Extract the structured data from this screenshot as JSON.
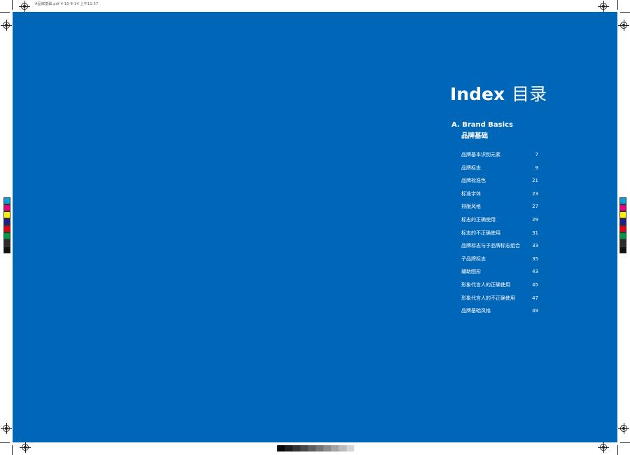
{
  "slug_text": "A品牌基础.pdf  4   10-8-14   上午11:57",
  "colors": {
    "page_blue": "#0066b8",
    "text": "#ffffff"
  },
  "toc": {
    "title_en": "Index",
    "title_zh": "目录",
    "section": {
      "label_en": "A. Brand Basics",
      "label_zh": "品牌基础"
    },
    "items": [
      {
        "label": "品牌基本识别元素",
        "page": "7"
      },
      {
        "label": "品牌标志",
        "page": "9"
      },
      {
        "label": "品牌标准色",
        "page": "21"
      },
      {
        "label": "标准字体",
        "page": "23"
      },
      {
        "label": "排版风格",
        "page": "27"
      },
      {
        "label": "标志的正确使用",
        "page": "29"
      },
      {
        "label": "标志的不正确使用",
        "page": "31"
      },
      {
        "label": "品牌标志与子品牌标志组合",
        "page": "33"
      },
      {
        "label": "子品牌标志",
        "page": "35"
      },
      {
        "label": "辅助图形",
        "page": "43"
      },
      {
        "label": "形象代言人的正确使用",
        "page": "45"
      },
      {
        "label": "形象代言人的不正确使用",
        "page": "47"
      },
      {
        "label": "品牌基础风格",
        "page": "49"
      }
    ]
  }
}
